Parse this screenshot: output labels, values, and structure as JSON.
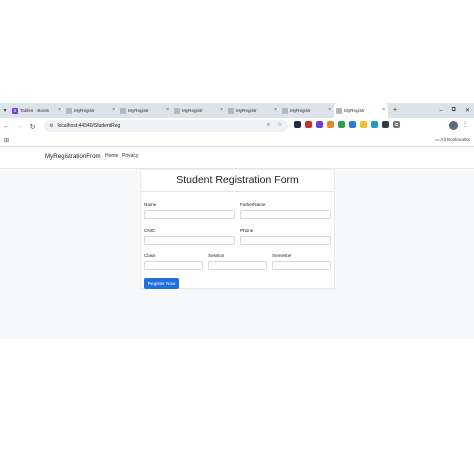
{
  "browser": {
    "tabs": [
      {
        "label": "Tables · Boots",
        "active": false,
        "favicon_color": "#7b3fe4",
        "favicon_letter": "B"
      },
      {
        "label": "MyRegistr",
        "active": false,
        "favicon_color": "#b0b8c4",
        "favicon_letter": ""
      },
      {
        "label": "MyRegistr",
        "active": false,
        "favicon_color": "#b0b8c4",
        "favicon_letter": ""
      },
      {
        "label": "MyRegistr",
        "active": false,
        "favicon_color": "#b0b8c4",
        "favicon_letter": ""
      },
      {
        "label": "MyRegistr",
        "active": false,
        "favicon_color": "#b0b8c4",
        "favicon_letter": ""
      },
      {
        "label": "MyRegistr",
        "active": false,
        "favicon_color": "#b0b8c4",
        "favicon_letter": ""
      },
      {
        "label": "MyRegistr",
        "active": true,
        "favicon_color": "#b0b8c4",
        "favicon_letter": ""
      }
    ],
    "new_tab_glyph": "+",
    "window_controls": [
      "–",
      "⧉",
      "✕"
    ],
    "url": "localhost:44340/StudentReg",
    "bookmarks_label": "All Bookmarks",
    "extensions": [
      {
        "name": "shield-extension-icon",
        "color": "#1f2a44"
      },
      {
        "name": "red-extension-icon",
        "color": "#c8312d"
      },
      {
        "name": "purple-extension-icon",
        "color": "#6a3fd6"
      },
      {
        "name": "orange-extension-icon",
        "color": "#e8862b"
      },
      {
        "name": "green-extension-icon",
        "color": "#2f9e5b"
      },
      {
        "name": "blue-extension-icon",
        "color": "#2c7be5"
      },
      {
        "name": "yellow-extension-icon",
        "color": "#f1c232"
      },
      {
        "name": "teal-extension-icon",
        "color": "#17a2b8"
      },
      {
        "name": "dark-extension-icon",
        "color": "#333a45"
      }
    ]
  },
  "app": {
    "brand": "MyRegistrationFrom",
    "nav": [
      "Home",
      "Privacy"
    ]
  },
  "form": {
    "title": "Student Registration Form",
    "fields": {
      "name": {
        "label": "Name",
        "value": ""
      },
      "father_name": {
        "label": "FatherName",
        "value": ""
      },
      "cnic": {
        "label": "CNIC",
        "value": ""
      },
      "phone": {
        "label": "Phone",
        "value": ""
      },
      "class": {
        "label": "Class",
        "value": ""
      },
      "session": {
        "label": "Session",
        "value": ""
      },
      "semester": {
        "label": "Semester",
        "value": ""
      }
    },
    "submit_label": "Register Now"
  },
  "colors": {
    "primary_button": "#1f6fe0",
    "tab_strip": "#dde3ea"
  }
}
